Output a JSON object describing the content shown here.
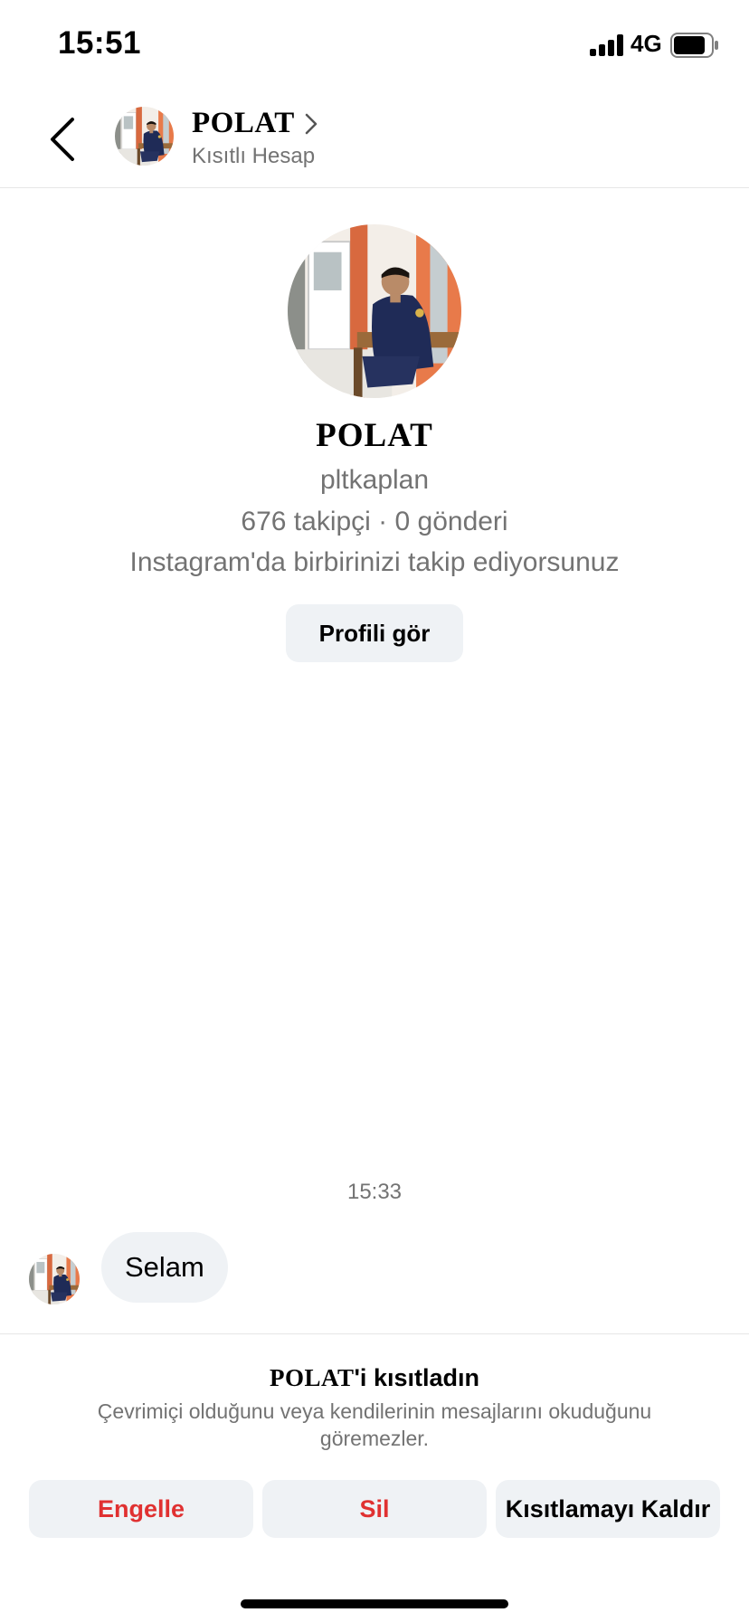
{
  "status_bar": {
    "time": "15:51",
    "network": "4G"
  },
  "header": {
    "name": "POLAT",
    "subtitle": "Kısıtlı Hesap"
  },
  "profile": {
    "name": "POLAT",
    "username": "pltkaplan",
    "stats": "676 takipçi · 0 gönderi",
    "mutual": "Instagram'da birbirinizi takip ediyorsunuz",
    "view_profile_label": "Profili gör"
  },
  "chat": {
    "timestamp": "15:33",
    "messages": [
      {
        "text": "Selam",
        "from": "POLAT"
      }
    ]
  },
  "restrict_panel": {
    "title_name": "POLAT",
    "title_suffix": "'i kısıtladın",
    "description": "Çevrimiçi olduğunu veya kendilerinin mesajlarını okuduğunu göremezler.",
    "actions": {
      "block": "Engelle",
      "delete": "Sil",
      "unrestrict": "Kısıtlamayı Kaldır"
    }
  },
  "colors": {
    "danger": "#e03131",
    "secondary_text": "#737373",
    "button_bg": "#eff2f5"
  },
  "icons": [
    "back-chevron-icon",
    "chevron-right-icon",
    "signal-icon",
    "battery-icon"
  ]
}
